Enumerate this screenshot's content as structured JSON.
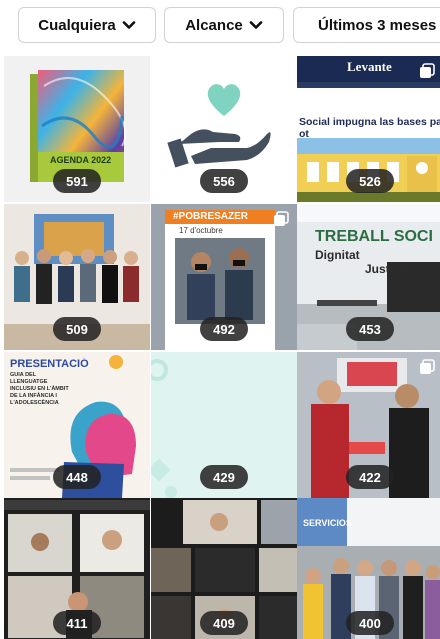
{
  "filters": [
    {
      "label": "Cualquiera",
      "icon": "chevron-down-icon"
    },
    {
      "label": "Alcance",
      "icon": "chevron-down-icon"
    },
    {
      "label": "Últimos 3 meses",
      "icon": "chevron-down-icon"
    }
  ],
  "posts": [
    {
      "metric": "591",
      "subject": "Agenda 2022 book cover",
      "cover_text": "AGENDA 2022",
      "multi": false
    },
    {
      "metric": "556",
      "subject": "heart-in-hand icon",
      "multi": false
    },
    {
      "metric": "526",
      "subject": "Levante newspaper clipping",
      "header": "Levante",
      "headline": "Social impugna las bases para una plaza",
      "headline_tail": "ot",
      "multi": true
    },
    {
      "metric": "509",
      "subject": "group photo of six women",
      "multi": false
    },
    {
      "metric": "492",
      "subject": "two men holding #POBRESAZER frame",
      "frame_title": "#POBRESAZER",
      "frame_date": "17 d'octubre",
      "multi": true
    },
    {
      "metric": "453",
      "subject": "Treball Social Dignitat i Justícia office",
      "wall_line1": "TREBALL SOCI",
      "wall_line2": "Dignitat",
      "wall_line3": "Justícia",
      "multi": false
    },
    {
      "metric": "448",
      "subject": "Presentació guide poster",
      "poster_title": "PRESENTACIÓ",
      "poster_subtitle": "GUIA DEL LLENGUATGE INCLUSIU EN L'ÀMBIT DE LA INFÀNCIA I L'ADOLESCÈNCIA",
      "multi": false
    },
    {
      "metric": "429",
      "subject": "light teal pattern",
      "multi": false
    },
    {
      "metric": "422",
      "subject": "two women holding a book",
      "multi": true
    },
    {
      "metric": "411",
      "subject": "video call grid",
      "multi": false
    },
    {
      "metric": "409",
      "subject": "video call grid",
      "multi": false
    },
    {
      "metric": "400",
      "subject": "group photo at Servicios sign",
      "sign_text": "SERVICIOS",
      "multi": false
    }
  ],
  "colors": {
    "badge_bg": "#222222",
    "chip_border": "#cfd3d8",
    "heart": "#7fd3c0",
    "hand": "#44505e"
  }
}
